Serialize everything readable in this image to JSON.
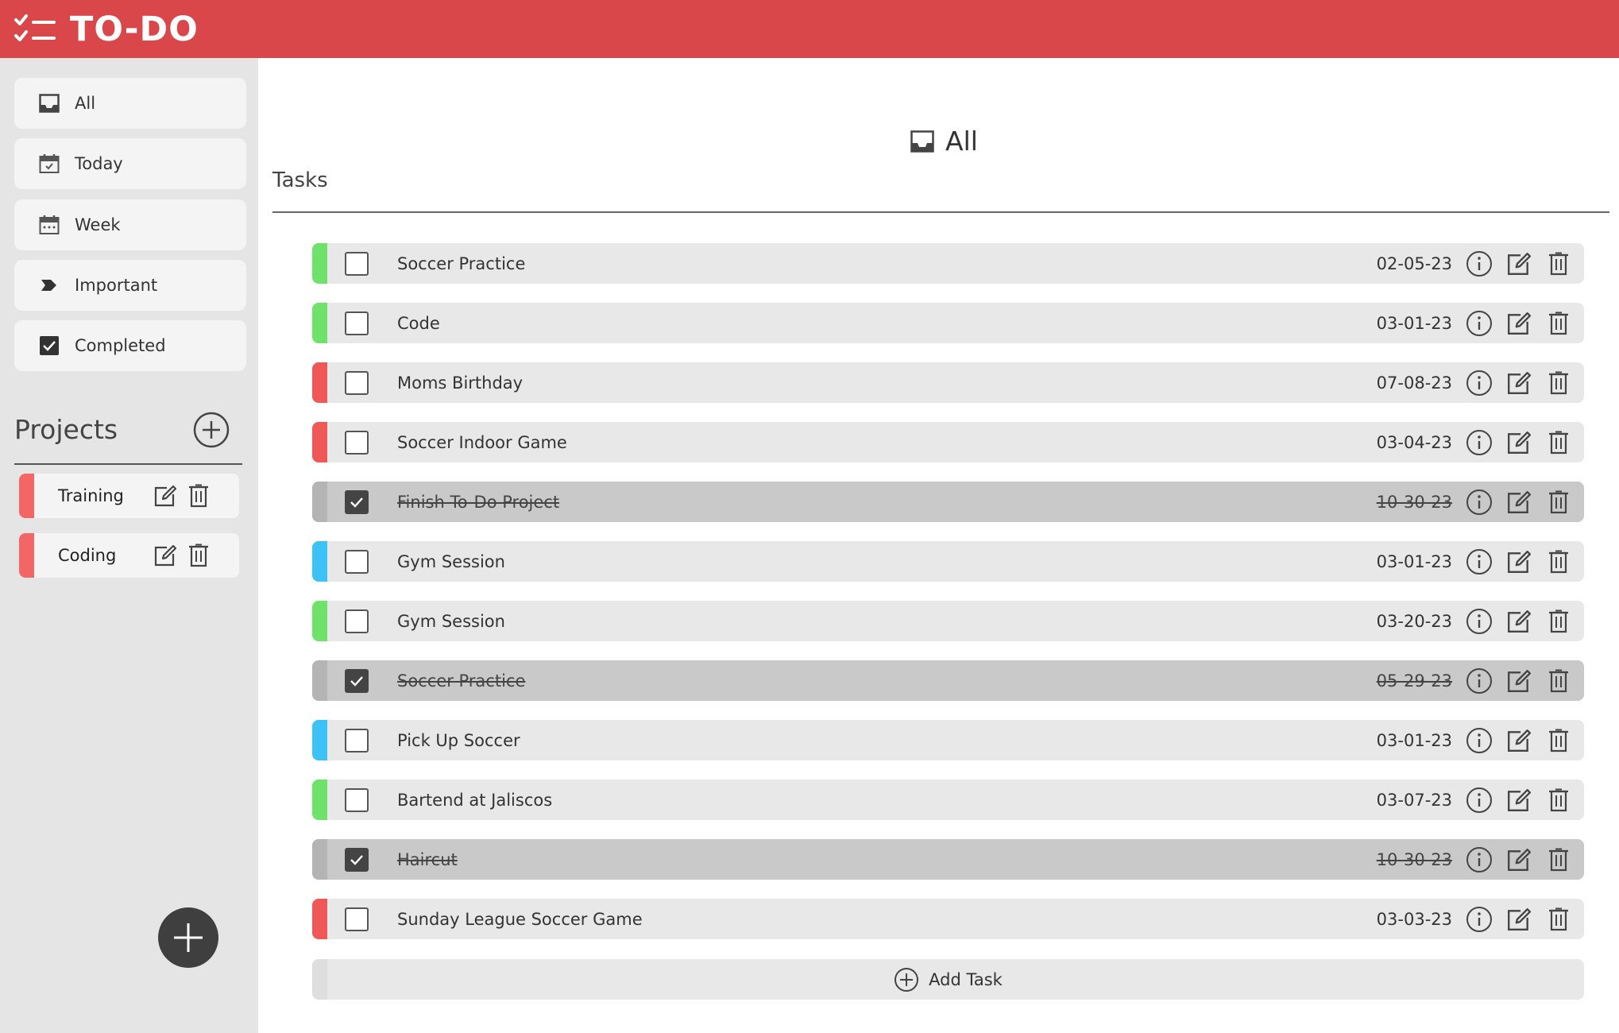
{
  "header": {
    "title": "TO-DO"
  },
  "sidebar": {
    "nav": [
      {
        "label": "All",
        "icon": "inbox-icon"
      },
      {
        "label": "Today",
        "icon": "calendar-today-icon"
      },
      {
        "label": "Week",
        "icon": "calendar-week-icon"
      },
      {
        "label": "Important",
        "icon": "label-icon"
      },
      {
        "label": "Completed",
        "icon": "checkbox-checked-icon"
      }
    ],
    "projects_title": "Projects",
    "projects": [
      {
        "label": "Training",
        "color": "#f26666"
      },
      {
        "label": "Coding",
        "color": "#f26666"
      }
    ]
  },
  "main": {
    "view_title": "All",
    "tasks_label": "Tasks",
    "add_task_label": "Add Task",
    "tasks": [
      {
        "name": "Soccer Practice",
        "date": "02-05-23",
        "priority_color": "#6ee26a",
        "completed": false
      },
      {
        "name": "Code",
        "date": "03-01-23",
        "priority_color": "#6ee26a",
        "completed": false
      },
      {
        "name": "Moms Birthday",
        "date": "07-08-23",
        "priority_color": "#f05757",
        "completed": false
      },
      {
        "name": "Soccer Indoor Game",
        "date": "03-04-23",
        "priority_color": "#f05757",
        "completed": false
      },
      {
        "name": "Finish To-Do Project",
        "date": "10-30-23",
        "priority_color": "#b4b4b4",
        "completed": true
      },
      {
        "name": "Gym Session",
        "date": "03-01-23",
        "priority_color": "#3dc2f5",
        "completed": false
      },
      {
        "name": "Gym Session",
        "date": "03-20-23",
        "priority_color": "#6ee26a",
        "completed": false
      },
      {
        "name": "Soccer Practice",
        "date": "05-29-23",
        "priority_color": "#b4b4b4",
        "completed": true
      },
      {
        "name": "Pick Up Soccer",
        "date": "03-01-23",
        "priority_color": "#3dc2f5",
        "completed": false
      },
      {
        "name": "Bartend at Jaliscos",
        "date": "03-07-23",
        "priority_color": "#6ee26a",
        "completed": false
      },
      {
        "name": "Haircut",
        "date": "10-30-23",
        "priority_color": "#b4b4b4",
        "completed": true
      },
      {
        "name": "Sunday League Soccer Game",
        "date": "03-03-23",
        "priority_color": "#f05757",
        "completed": false
      }
    ]
  },
  "colors": {
    "header": "#d9474b",
    "sidebar": "#e5e5e5",
    "fab": "#3f3f3f"
  }
}
